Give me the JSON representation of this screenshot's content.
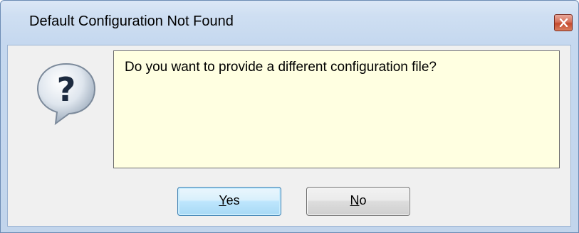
{
  "window": {
    "title": "Default Configuration Not Found"
  },
  "titlebar": {
    "close_icon": "close-icon"
  },
  "dialog": {
    "icon": "question-icon",
    "icon_glyph": "?",
    "message": "Do you want to provide a different configuration file?"
  },
  "buttons": {
    "yes": {
      "mnemonic": "Y",
      "rest": "es"
    },
    "no": {
      "mnemonic": "N",
      "rest": "o"
    }
  },
  "colors": {
    "message_background": "#ffffe1",
    "close_button": "#c44a2d",
    "default_button_border": "#3c7fb1"
  }
}
